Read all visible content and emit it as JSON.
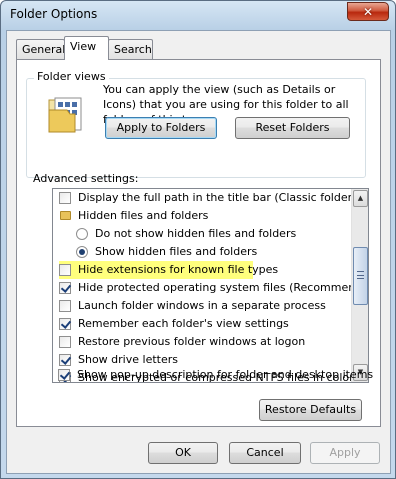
{
  "window": {
    "title": "Folder Options",
    "close_glyph": "✕"
  },
  "tabs": [
    {
      "label": "General"
    },
    {
      "label": "View"
    },
    {
      "label": "Search"
    }
  ],
  "folder_views": {
    "group_label": "Folder views",
    "description": "You can apply the view (such as Details or Icons) that you are using for this folder to all folders of this type.",
    "apply_button": "Apply to Folders",
    "reset_button": "Reset Folders"
  },
  "advanced": {
    "label": "Advanced settings:",
    "items": [
      {
        "label": "Display the full path in the title bar (Classic folders only)",
        "type": "checkbox",
        "checked": false
      },
      {
        "label": "Hidden files and folders",
        "type": "folder"
      },
      {
        "label": "Do not show hidden files and folders",
        "type": "radio",
        "checked": false
      },
      {
        "label": "Show hidden files and folders",
        "type": "radio",
        "checked": true
      },
      {
        "label": "Hide extensions for known file types",
        "type": "checkbox",
        "checked": false,
        "highlighted": true
      },
      {
        "label": "Hide protected operating system files (Recommended)",
        "type": "checkbox",
        "checked": true
      },
      {
        "label": "Launch folder windows in a separate process",
        "type": "checkbox",
        "checked": false
      },
      {
        "label": "Remember each folder's view settings",
        "type": "checkbox",
        "checked": true
      },
      {
        "label": "Restore previous folder windows at logon",
        "type": "checkbox",
        "checked": false
      },
      {
        "label": "Show drive letters",
        "type": "checkbox",
        "checked": true
      },
      {
        "label": "Show encrypted or compressed NTFS files in color",
        "type": "checkbox",
        "checked": true
      },
      {
        "label": "Show pop-up description for folder and desktop items",
        "type": "checkbox",
        "checked": true
      }
    ],
    "highlight_color": "#ffff66",
    "scroll_up_glyph": "▲",
    "scroll_down_glyph": "▼",
    "scroll_position": 0.4
  },
  "buttons": {
    "restore_defaults": "Restore Defaults",
    "ok": "OK",
    "cancel": "Cancel",
    "apply": "Apply"
  },
  "icons": {
    "close": "close-icon",
    "folder_views": "folder-views-icon",
    "folder": "folder-icon"
  }
}
